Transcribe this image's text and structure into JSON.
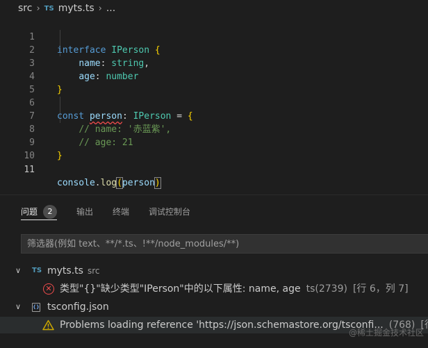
{
  "breadcrumb": {
    "folder": "src",
    "file_badge": "TS",
    "file": "myts.ts",
    "trailing": "..."
  },
  "editor": {
    "lines": [
      {
        "n": "1"
      },
      {
        "n": "2"
      },
      {
        "n": "3"
      },
      {
        "n": "4"
      },
      {
        "n": "5"
      },
      {
        "n": "6"
      },
      {
        "n": "7"
      },
      {
        "n": "8"
      },
      {
        "n": "9"
      },
      {
        "n": "10"
      },
      {
        "n": "11"
      }
    ],
    "tokens": {
      "interface": "interface",
      "IPerson": "IPerson",
      "lbrace": "{",
      "rbrace": "}",
      "name": "name",
      "colon": ":",
      "string": "string",
      "comma": ",",
      "age": "age",
      "number": "number",
      "const": "const",
      "person": "person",
      "eq": "=",
      "comment1": "// name: '赤蓝紫',",
      "comment2": "// age: 21",
      "console": "console",
      "dot": ".",
      "log": "log",
      "lparen": "(",
      "rparen": ")"
    }
  },
  "panel": {
    "tabs": [
      {
        "label": "问题",
        "badge": "2"
      },
      {
        "label": "输出"
      },
      {
        "label": "终端"
      },
      {
        "label": "调试控制台"
      }
    ],
    "filter_placeholder": "筛选器(例如 text、**/*.ts、!**/node_modules/**)",
    "problems": [
      {
        "file": "myts.ts",
        "badge": "TS",
        "dir": "src",
        "items": [
          {
            "severity": "error",
            "message": "类型\"{}\"缺少类型\"IPerson\"中的以下属性: name, age",
            "source": "ts(2739)",
            "position": "[行 6，列 7]"
          }
        ]
      },
      {
        "file": "tsconfig.json",
        "badge": "{}",
        "items": [
          {
            "severity": "warning",
            "message": "Problems loading reference 'https://json.schemastore.org/tsconfi...",
            "source": "(768)",
            "position": "[行"
          }
        ]
      }
    ]
  },
  "watermark": "@稀土掘金技术社区",
  "colors": {
    "error": "#f14c4c",
    "warning": "#cca700",
    "ts": "#519aba",
    "background": "#1e1e1e"
  }
}
